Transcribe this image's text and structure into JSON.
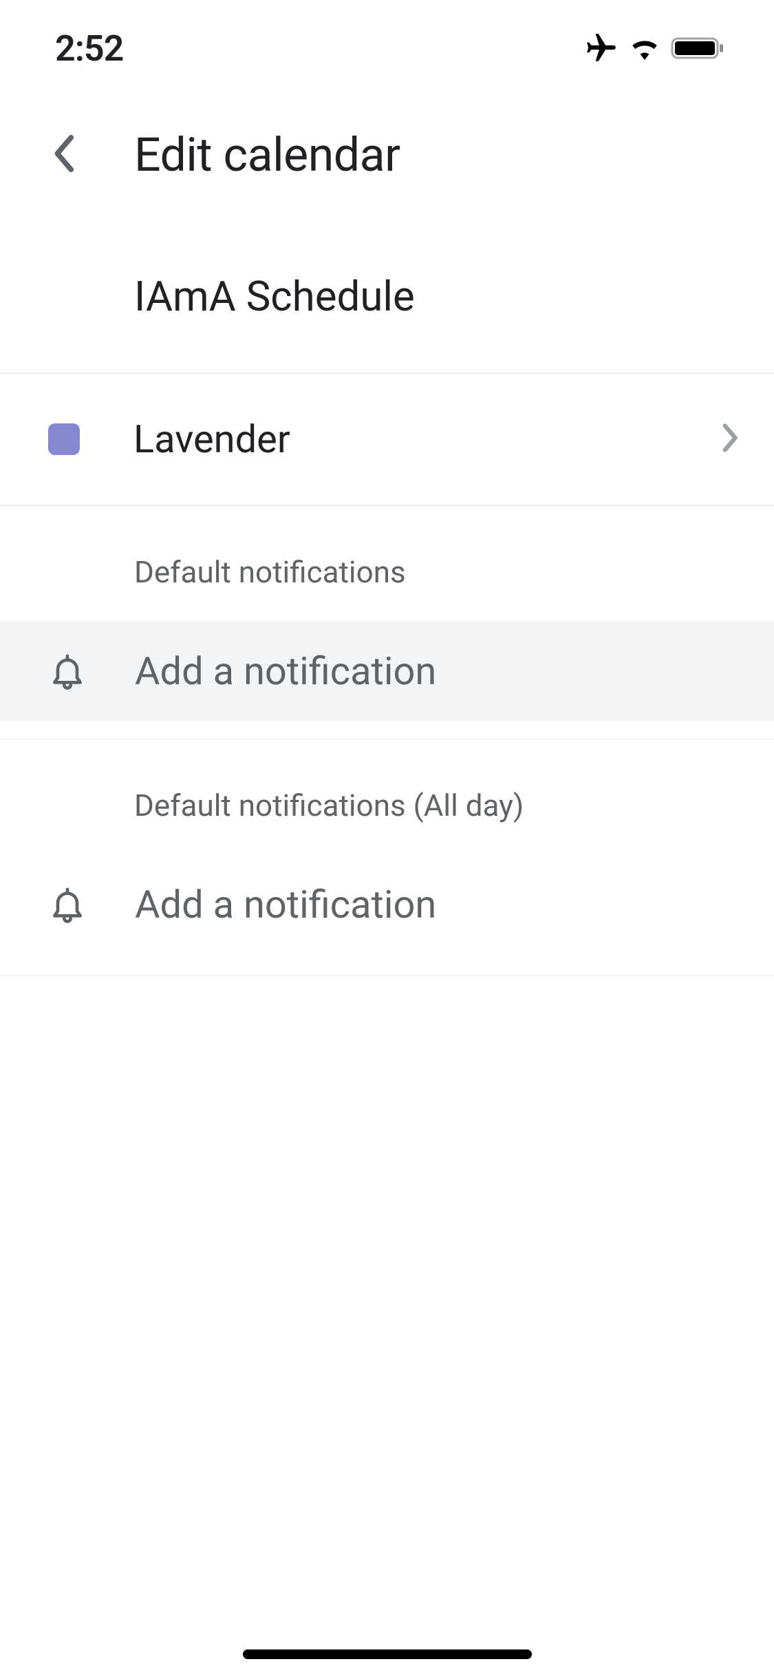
{
  "status": {
    "time": "2:52"
  },
  "header": {
    "title": "Edit calendar"
  },
  "calendar": {
    "name": "IAmA Schedule"
  },
  "color": {
    "label": "Lavender",
    "hex": "#8388cf"
  },
  "sections": {
    "default_notifications": {
      "title": "Default notifications",
      "add_label": "Add a notification"
    },
    "default_notifications_all_day": {
      "title": "Default notifications (All day)",
      "add_label": "Add a notification"
    }
  }
}
